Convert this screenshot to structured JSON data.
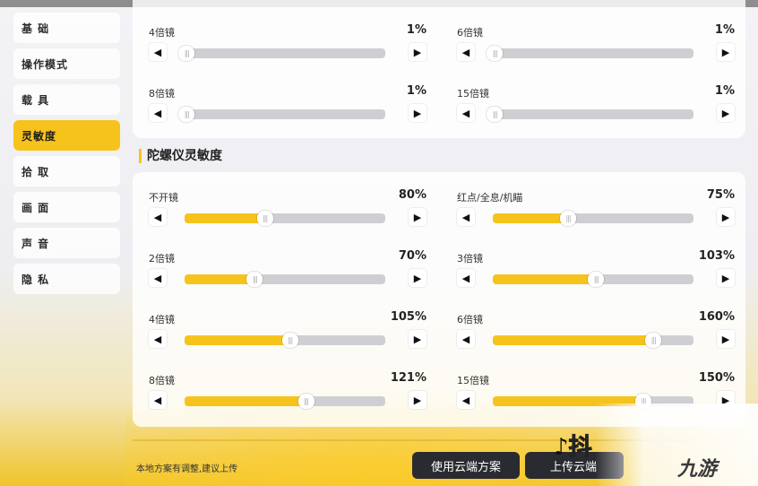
{
  "sidebar": {
    "items": [
      {
        "label": "基 础",
        "active": false
      },
      {
        "label": "操作模式",
        "active": false
      },
      {
        "label": "载 具",
        "active": false
      },
      {
        "label": "灵敏度",
        "active": true
      },
      {
        "label": "拾 取",
        "active": false
      },
      {
        "label": "画 面",
        "active": false
      },
      {
        "label": "声 音",
        "active": false
      },
      {
        "label": "隐 私",
        "active": false
      }
    ]
  },
  "top_panel": {
    "settings": [
      {
        "label": "4倍镜",
        "value": "1%",
        "level": 0.01
      },
      {
        "label": "6倍镜",
        "value": "1%",
        "level": 0.01
      },
      {
        "label": "8倍镜",
        "value": "1%",
        "level": 0.01
      },
      {
        "label": "15倍镜",
        "value": "1%",
        "level": 0.01
      }
    ]
  },
  "gyro": {
    "title": "陀螺仪灵敏度",
    "settings": [
      {
        "label": "不开镜",
        "value": "80%",
        "level": 0.4
      },
      {
        "label": "红点/全息/机瞄",
        "value": "75%",
        "level": 0.375
      },
      {
        "label": "2倍镜",
        "value": "70%",
        "level": 0.35
      },
      {
        "label": "3倍镜",
        "value": "103%",
        "level": 0.515
      },
      {
        "label": "4倍镜",
        "value": "105%",
        "level": 0.525
      },
      {
        "label": "6倍镜",
        "value": "160%",
        "level": 0.8
      },
      {
        "label": "8倍镜",
        "value": "121%",
        "level": 0.605
      },
      {
        "label": "15倍镜",
        "value": "150%",
        "level": 0.75
      }
    ]
  },
  "footer": {
    "note": "本地方案有调整,建议上传",
    "use_cloud_label": "使用云端方案",
    "upload_label": "上传云端"
  },
  "watermarks": {
    "tiktok": "抖",
    "site_logo": "九游"
  },
  "icons": {
    "left_arrow": "◀",
    "right_arrow": "▶",
    "thumb_grip": "|||"
  },
  "colors": {
    "accent": "#f6c31c",
    "track": "#cfcfd3",
    "button_dark": "#2a2b30"
  }
}
